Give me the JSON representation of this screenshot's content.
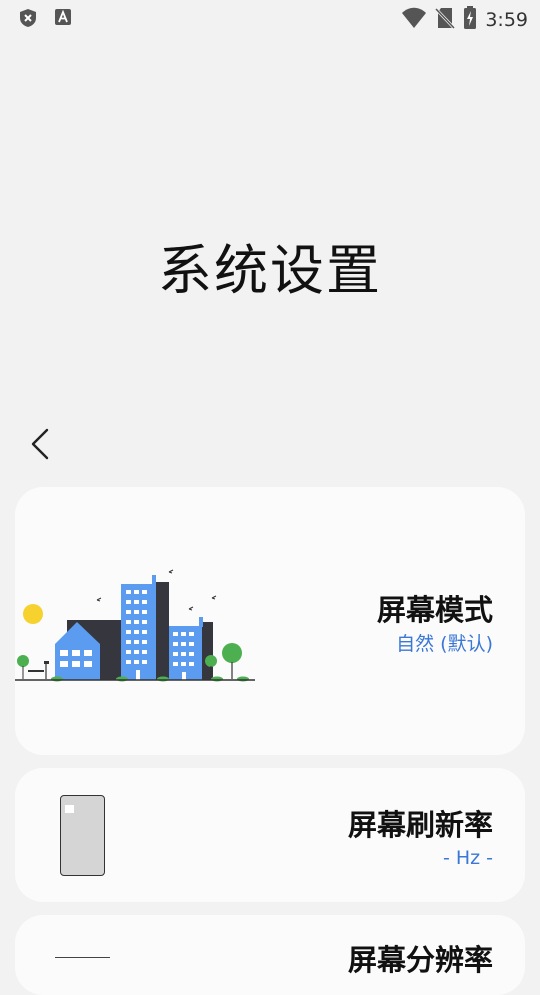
{
  "status_bar": {
    "time": "3:59",
    "icons": [
      "shield-x-icon",
      "font-a-icon",
      "wifi-icon",
      "no-sim-icon",
      "battery-charging-icon"
    ]
  },
  "page": {
    "title": "系统设置"
  },
  "cards": [
    {
      "title": "屏幕模式",
      "subtitle": "自然 (默认)",
      "illustration": "city-skyline"
    },
    {
      "title": "屏幕刷新率",
      "subtitle": "- Hz -",
      "illustration": "phone"
    },
    {
      "title": "屏幕分辨率",
      "subtitle": "",
      "illustration": "phone"
    }
  ],
  "colors": {
    "background": "#f2f2f2",
    "card": "#fbfbfb",
    "accent": "#3b78d6",
    "building_blue": "#5b9cf0",
    "building_dark": "#36363f",
    "sun": "#f7d22e",
    "tree": "#4caf50"
  }
}
